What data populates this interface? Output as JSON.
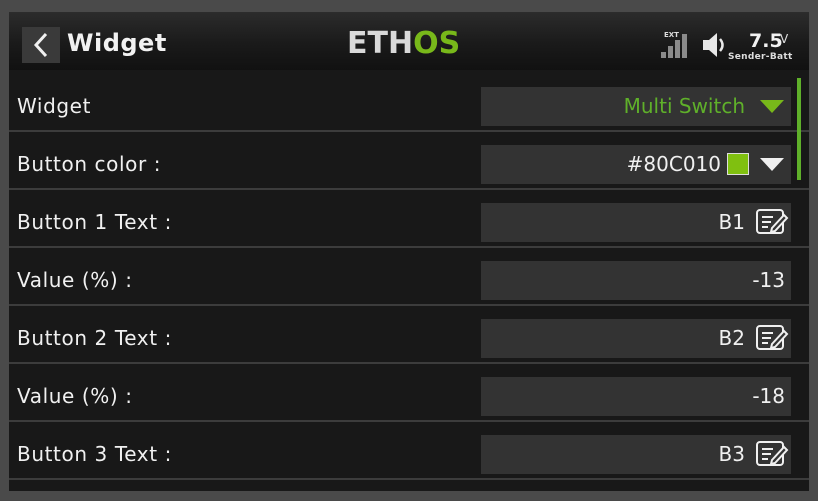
{
  "header": {
    "title": "Widget",
    "logo_left": "ETH",
    "logo_right": "OS",
    "ext_label": "EXT",
    "voltage": "7.5",
    "voltage_unit": "V",
    "battery_label": "Sender-Batt"
  },
  "rows": [
    {
      "label": "Widget",
      "value": "Multi Switch",
      "type": "dropdown"
    },
    {
      "label": "Button color :",
      "value": "#80C010",
      "type": "color-dropdown"
    },
    {
      "label": "Button 1 Text :",
      "value": "B1",
      "type": "text"
    },
    {
      "label": "Value (%) :",
      "value": "-13",
      "type": "number"
    },
    {
      "label": "Button 2 Text :",
      "value": "B2",
      "type": "text"
    },
    {
      "label": "Value (%) :",
      "value": "-18",
      "type": "number"
    },
    {
      "label": "Button 3 Text :",
      "value": "B3",
      "type": "text"
    }
  ],
  "colors": {
    "accent": "#78b81a",
    "button_color_swatch": "#80C010"
  }
}
